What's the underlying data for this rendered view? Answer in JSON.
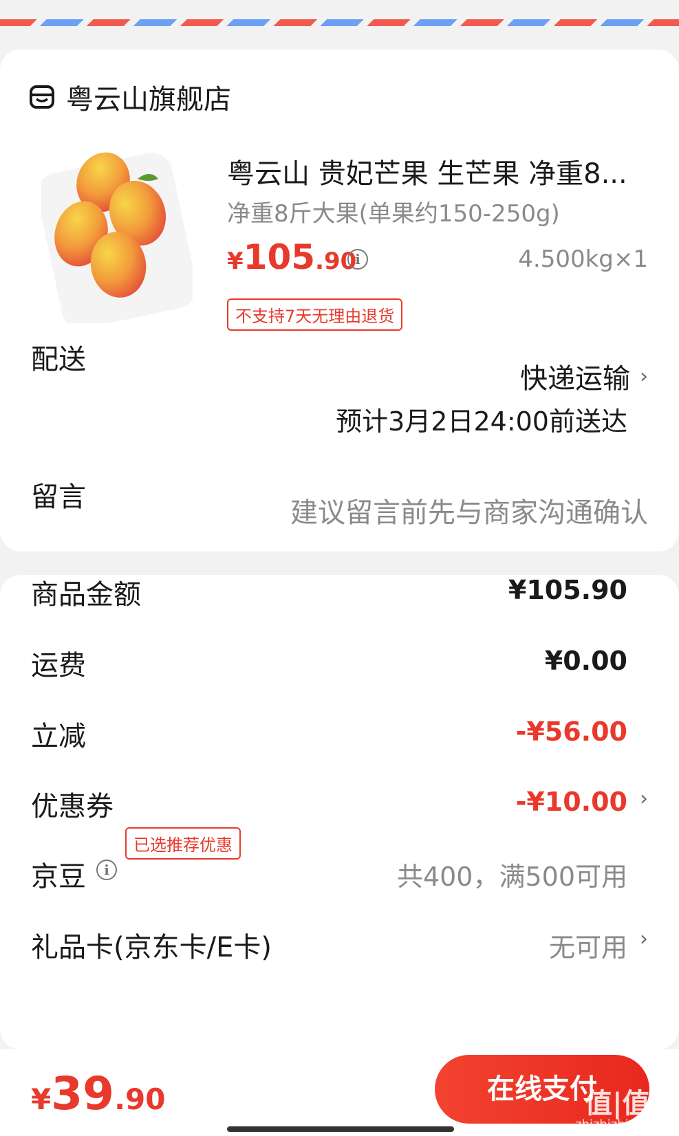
{
  "store": {
    "name": "粤云山旗舰店",
    "icon": "store-icon"
  },
  "product": {
    "title": "粤云山 贵妃芒果 生芒果 净重8...",
    "spec": "净重8斤大果(单果约150-250g)",
    "price_currency": "¥",
    "price_int": "105",
    "price_dec": ".90",
    "info_glyph": "i",
    "quantity": "4.500kg×1",
    "tag": "不支持7天无理由退货"
  },
  "delivery": {
    "label": "配送",
    "method": "快递运输",
    "eta": "预计3月2日24:00前送达"
  },
  "message": {
    "label": "留言",
    "placeholder": "建议留言前先与商家沟通确认"
  },
  "fees": {
    "goods_label": "商品金额",
    "goods_value": "¥105.90",
    "shipping_label": "运费",
    "shipping_value": "¥0.00",
    "discount_label": "立减",
    "discount_value": "-¥56.00",
    "coupon_label": "优惠券",
    "coupon_badge": "已选推荐优惠",
    "coupon_value": "-¥10.00",
    "jd_beans_label": "京豆",
    "jd_beans_value": "共400，满500可用",
    "giftcard_label": "礼品卡(京东卡/E卡)",
    "giftcard_value": "无可用"
  },
  "footer": {
    "total_currency": "¥",
    "total_int": "39",
    "total_dec": ".90",
    "pay_label": "在线支付",
    "watermark": "值|值|值",
    "watermark_sub": "zhizhizhi.com"
  },
  "colors": {
    "accent": "#e8392c",
    "muted": "#8a8a8a",
    "stripe_red": "#f05a4f",
    "stripe_blue": "#6d9ff2"
  },
  "chevron": "›"
}
